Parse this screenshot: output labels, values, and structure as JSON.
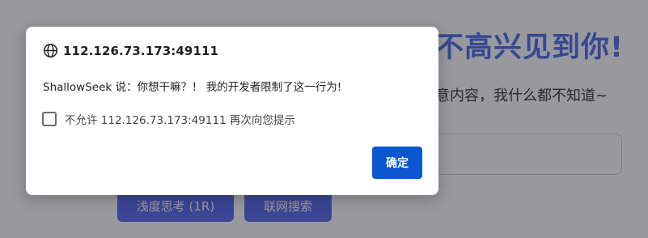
{
  "background": {
    "title": "不高兴见到你!",
    "subtitle": "意内容，我什么都不知道~",
    "buttons": {
      "shallow_think": "浅度思考 (1R)",
      "web_search": "联网搜索"
    }
  },
  "dialog": {
    "origin": "112.126.73.173:49111",
    "origin_icon": "globe-icon",
    "message": "ShallowSeek 说：你想干嘛？！ 我的开发者限制了这一行为!",
    "suppress_label": "不允许 112.126.73.173:49111 再次向您提示",
    "suppress_checked": false,
    "ok_label": "确定"
  },
  "colors": {
    "accent": "#0b57d0",
    "brand_blue": "#5468ee",
    "title_blue": "#4a6cf0"
  }
}
